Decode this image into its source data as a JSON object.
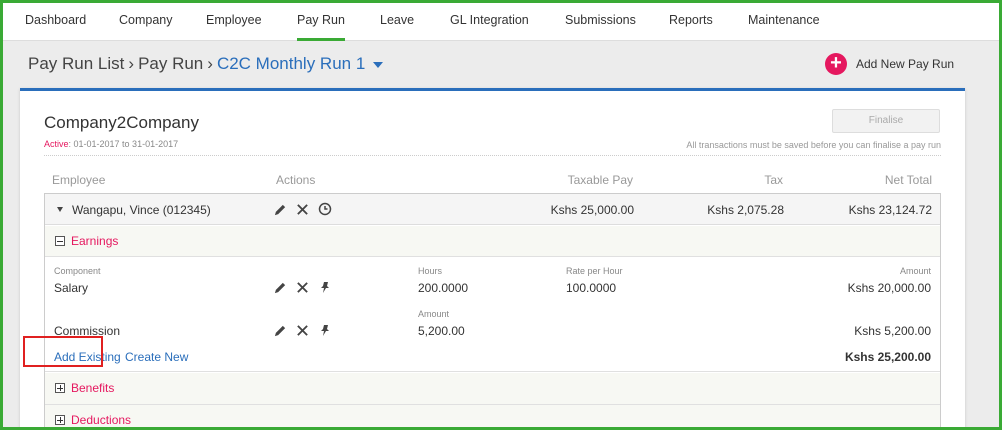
{
  "nav": {
    "items": [
      {
        "label": "Dashboard"
      },
      {
        "label": "Company"
      },
      {
        "label": "Employee"
      },
      {
        "label": "Pay Run"
      },
      {
        "label": "Leave"
      },
      {
        "label": "GL Integration"
      },
      {
        "label": "Submissions"
      },
      {
        "label": "Reports"
      },
      {
        "label": "Maintenance"
      }
    ],
    "active": "Pay Run"
  },
  "breadcrumb": {
    "items": [
      "Pay Run List",
      "Pay Run"
    ],
    "separator": "›",
    "current": "C2C Monthly Run 1"
  },
  "add_new": {
    "label": "Add New Pay Run",
    "icon": "plus-circle-icon"
  },
  "company": {
    "name": "Company2Company",
    "active_label": "Active",
    "period": ": 01-01-2017 to 31-01-2017"
  },
  "finalise": {
    "label": "Finalise",
    "note": "All transactions must be saved before you can finalise a pay run"
  },
  "table": {
    "headers": {
      "employee": "Employee",
      "actions": "Actions",
      "taxable": "Taxable Pay",
      "tax": "Tax",
      "net": "Net Total"
    },
    "employee": {
      "name": "Wangapu, Vince (012345)",
      "taxable": "Kshs 25,000.00",
      "tax": "Kshs 2,075.28",
      "net": "Kshs 23,124.72"
    }
  },
  "earnings": {
    "label": "Earnings",
    "col_component": "Component",
    "col_amount": "Amount",
    "rows": [
      {
        "name": "Salary",
        "qty_label": "Hours",
        "qty": "200.0000",
        "rate_label": "Rate per Hour",
        "rate": "100.0000",
        "amount": "Kshs 20,000.00"
      },
      {
        "name": "Commission",
        "qty_label": "Amount",
        "qty": "5,200.00",
        "amount": "Kshs 5,200.00"
      }
    ],
    "add_existing": "Add Existing",
    "create_new": "Create New",
    "total": "Kshs 25,200.00"
  },
  "sections": {
    "benefits": "Benefits",
    "deductions": "Deductions"
  },
  "colors": {
    "accent_green": "#3aaa35",
    "brand_pink": "#e5185f",
    "link_blue": "#2a6ebb",
    "highlight_red": "#e02020"
  }
}
